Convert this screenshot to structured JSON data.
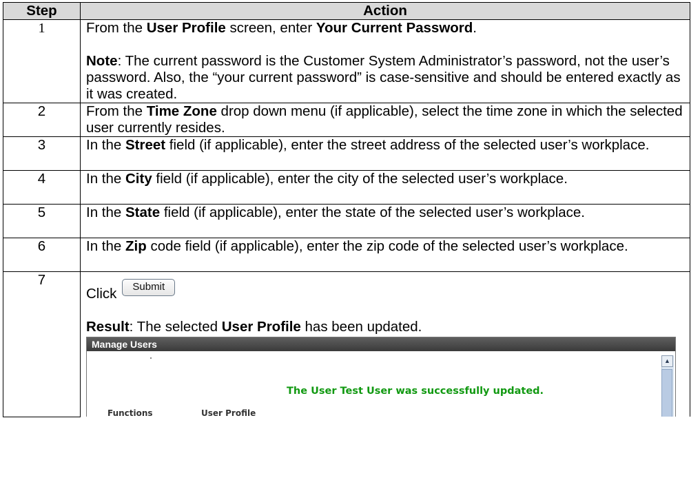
{
  "table": {
    "header_step": "Step",
    "header_action": "Action"
  },
  "steps": [
    {
      "num": "1",
      "p1": [
        "From the ",
        "User Profile",
        " screen, enter ",
        "Your Current Password",
        "."
      ],
      "note_label": "Note",
      "note_text": ":  The current password is the Customer System Administrator’s password, not the user’s password.  Also, the “your current password” is case-sensitive and should be entered exactly as it was created."
    },
    {
      "num": "2",
      "parts": [
        "From the ",
        "Time Zone",
        " drop down menu (if applicable), select the time zone in which the selected user currently resides."
      ]
    },
    {
      "num": "3",
      "parts": [
        "In the ",
        "Street",
        " field (if applicable), enter the street address of the selected user’s workplace."
      ]
    },
    {
      "num": "4",
      "parts": [
        "In the ",
        "City",
        " field (if applicable), enter the city of the selected user’s workplace."
      ]
    },
    {
      "num": "5",
      "parts": [
        "In the ",
        "State",
        " field (if applicable), enter the state of the selected user’s workplace."
      ]
    },
    {
      "num": "6",
      "parts": [
        "In the ",
        "Zip",
        " code field (if applicable), enter the zip code of the selected user’s workplace."
      ]
    },
    {
      "num": "7",
      "click_text": "Click",
      "button_label": "Submit",
      "result_label": "Result",
      "result_parts": [
        ":  The selected ",
        "User Profile",
        " has been updated."
      ]
    }
  ],
  "screenshot": {
    "window_title": "Manage Users",
    "success_message": "The User Test User was successfully updated.",
    "functions_label": "Functions",
    "user_profile_label": "User Profile",
    "scroll_up_icon": "▲",
    "success_color": "#119911"
  }
}
